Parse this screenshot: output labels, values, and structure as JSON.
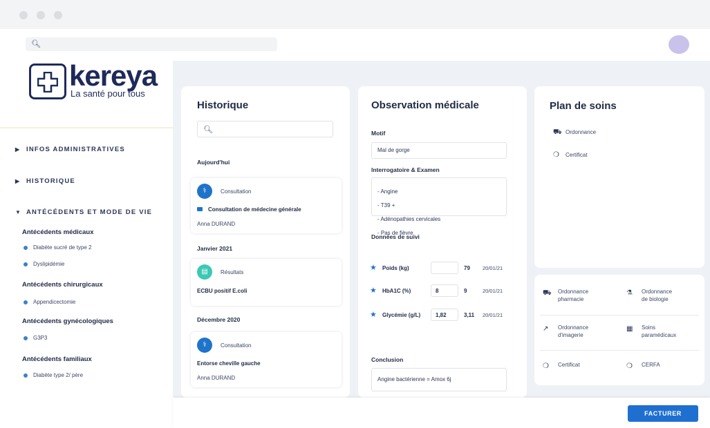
{
  "brand": {
    "name": "kereya",
    "tagline": "La santé pour tous"
  },
  "search": {
    "top_placeholder": "",
    "history_placeholder": ""
  },
  "sidebar": {
    "nav": [
      {
        "label": "INFOS ADMINISTRATIVES",
        "expanded": false
      },
      {
        "label": "HISTORIQUE",
        "expanded": false
      },
      {
        "label": "ANTÉCÉDENTS ET MODE DE VIE",
        "expanded": true
      }
    ],
    "antecedents": [
      {
        "title": "Antécédents médicaux",
        "items": [
          "Diabète sucré de type 2",
          "Dyslipidémie"
        ]
      },
      {
        "title": "Antécédents chirurgicaux",
        "items": [
          "Appendicectomie"
        ]
      },
      {
        "title": "Antécédents gynécologiques",
        "items": [
          "G3P3"
        ]
      },
      {
        "title": "Antécédents familiaux",
        "items": [
          "Diabète type 2/ père"
        ]
      }
    ]
  },
  "historique": {
    "title": "Historique",
    "groups": [
      {
        "date": "Aujourd'hui",
        "entry": {
          "type": "Consultation",
          "desc": "Consultation de médecine générale",
          "author": "Anna DURAND"
        }
      },
      {
        "date": "Janvier 2021",
        "entry": {
          "type": "Résultats",
          "desc": "ECBU positif E.coli",
          "author": ""
        }
      },
      {
        "date": "Décembre 2020",
        "entry": {
          "type": "Consultation",
          "desc": "Entorse cheville gauche",
          "author": "Anna DURAND"
        }
      }
    ]
  },
  "observation": {
    "title": "Observation médicale",
    "motif_label": "Motif",
    "motif_value": "Mal de gorge",
    "exam_label": "Interrogatoire & Examen",
    "exam_lines": [
      "- Angine",
      "- T39 +",
      "- Adénopathies cervicales",
      "- Pas de fièvre"
    ],
    "suivi_label": "Données de suivi",
    "suivi": [
      {
        "label": "Poids (kg)",
        "input": "",
        "value": "79",
        "date": "20/01/21"
      },
      {
        "label": "HbA1C (%)",
        "input": "8",
        "value": "9",
        "date": "20/01/21"
      },
      {
        "label": "Glycémie (g/L)",
        "input": "1,82",
        "value": "3,11",
        "date": "20/01/21"
      }
    ],
    "conclusion_label": "Conclusion",
    "conclusion_value": "Angine bactérienne = Amox 6j"
  },
  "plan": {
    "title": "Plan de soins",
    "items": [
      {
        "label": "Ordonnance",
        "icon": "truck-icon"
      },
      {
        "label": "Certificat",
        "icon": "certificate-icon"
      }
    ]
  },
  "actions": [
    {
      "line1": "Ordonnance",
      "line2": "pharmacie",
      "icon": "truck-icon"
    },
    {
      "line1": "Ordonnance",
      "line2": "de biologie",
      "icon": "flask-icon"
    },
    {
      "line1": "Ordonnance",
      "line2": "d'imagerie",
      "icon": "scan-icon"
    },
    {
      "line1": "Soins",
      "line2": "paramédicaux",
      "icon": "care-icon"
    },
    {
      "line1": "Certificat",
      "line2": "",
      "icon": "certificate-icon"
    },
    {
      "line1": "CERFA",
      "line2": "",
      "icon": "cerfa-icon"
    }
  ],
  "footer": {
    "facturer_label": "FACTURER"
  },
  "colors": {
    "primary": "#1f6fd1",
    "accent_blue": "#1e74c9",
    "results_teal": "#3cc8b4",
    "navy": "#1f2a5a"
  }
}
